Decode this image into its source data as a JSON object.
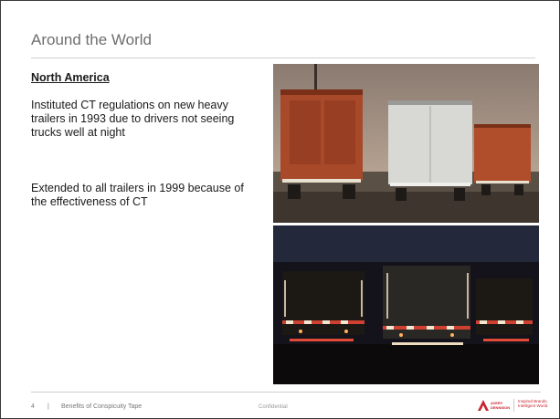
{
  "slide": {
    "title": "Around the World",
    "heading": "North America",
    "paragraphs": [
      "Instituted CT regulations on new heavy trailers in 1993 due to drivers not seeing trucks well at night",
      "Extended to all trailers in 1999 because of the effectiveness of CT"
    ]
  },
  "footer": {
    "page_number": "4",
    "separator": "|",
    "title": "Benefits of Conspicuity Tape",
    "confidential": "Confidential",
    "logo_text": "AVERY DENNISON",
    "tagline": "Inspired Brands. Intelligent World."
  },
  "colors": {
    "accent_red": "#c8262f",
    "title_gray": "#6e6e6e"
  }
}
